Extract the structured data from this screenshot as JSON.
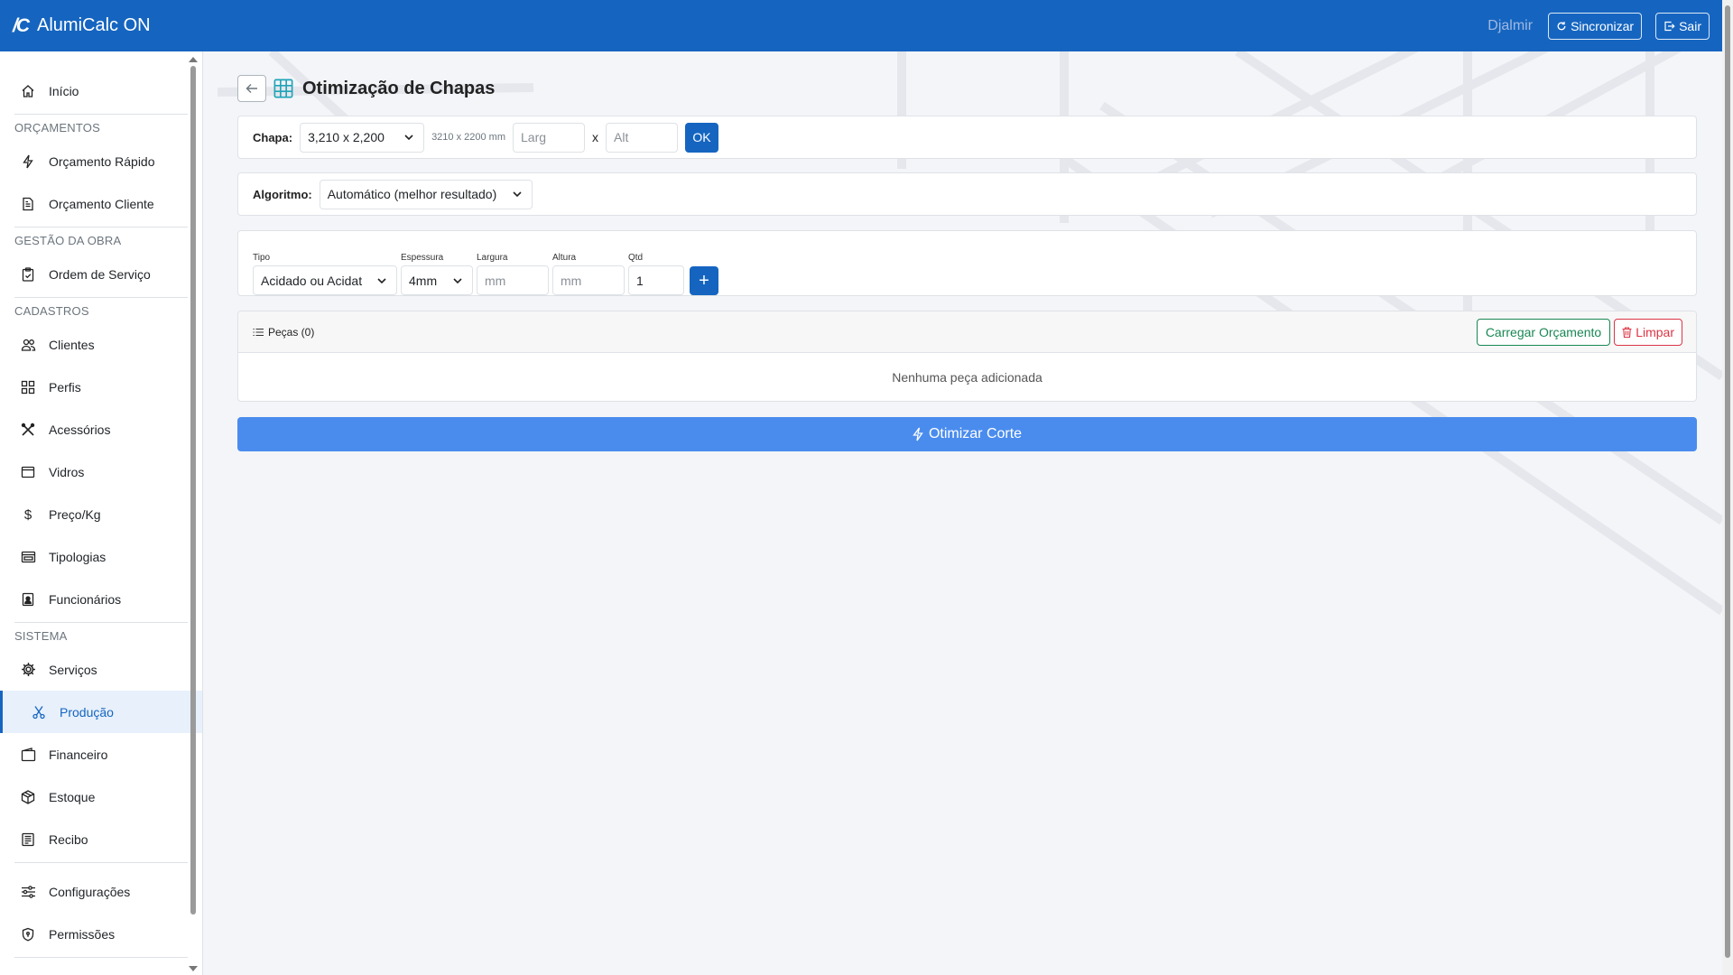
{
  "app": {
    "title": "AlumiCalc ON",
    "logo_text": "/C"
  },
  "navbar": {
    "user": "Djalmir",
    "sync_label": "Sincronizar",
    "logout_label": "Sair"
  },
  "sidebar": {
    "home": "Início",
    "section_orcamentos": "ORÇAMENTOS",
    "orcamento_rapido": "Orçamento Rápido",
    "orcamento_cliente": "Orçamento Cliente",
    "section_gestao": "GESTÃO DA OBRA",
    "ordem_servico": "Ordem de Serviço",
    "section_cadastros": "CADASTROS",
    "clientes": "Clientes",
    "perfis": "Perfis",
    "acessorios": "Acessórios",
    "vidros": "Vidros",
    "preco_kg": "Preço/Kg",
    "tipologias": "Tipologias",
    "funcionarios": "Funcionários",
    "section_sistema": "SISTEMA",
    "servicos": "Serviços",
    "producao": "Produção",
    "financeiro": "Financeiro",
    "estoque": "Estoque",
    "recibo": "Recibo",
    "configuracoes": "Configurações",
    "permissoes": "Permissões",
    "active_item": "Produção"
  },
  "page": {
    "title": "Otimização de Chapas",
    "chapa": {
      "label": "Chapa:",
      "selected": "3,210 x 2,200",
      "size_hint": "3210 x 2200 mm",
      "larg_placeholder": "Larg",
      "x_sep": "x",
      "alt_placeholder": "Alt",
      "ok_label": "OK"
    },
    "algoritmo": {
      "label": "Algoritmo:",
      "selected": "Automático (melhor resultado)"
    },
    "form": {
      "tipo_label": "Tipo",
      "tipo_value": "Acidado ou Acidat",
      "espessura_label": "Espessura",
      "espessura_value": "4mm",
      "largura_label": "Largura",
      "largura_placeholder": "mm",
      "altura_label": "Altura",
      "altura_placeholder": "mm",
      "qtd_label": "Qtd",
      "qtd_value": "1",
      "add_label": "+"
    },
    "pecas": {
      "title": "Peças (0)",
      "load_label": "Carregar Orçamento",
      "clear_label": "Limpar",
      "empty_message": "Nenhuma peça adicionada"
    },
    "optimize_label": "Otimizar Corte"
  },
  "colors": {
    "primary": "#1565c0",
    "optimize": "#4a8cee",
    "success": "#198754",
    "danger": "#dc3545",
    "active_bg": "#e7f0fb"
  }
}
